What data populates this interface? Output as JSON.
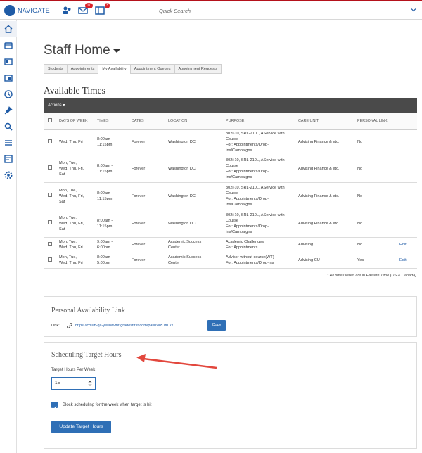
{
  "topbar": {
    "logo_text": "NAVIGATE",
    "badges": {
      "messages": "10",
      "tasks": "3"
    },
    "search_placeholder": "Quick Search"
  },
  "page": {
    "title": "Staff Home"
  },
  "tabs": [
    {
      "label": "Students"
    },
    {
      "label": "Appointments"
    },
    {
      "label": "My Availability"
    },
    {
      "label": "Appointment Queues"
    },
    {
      "label": "Appointment Requests"
    }
  ],
  "available": {
    "title": "Available Times",
    "actions_label": "Actions ▾",
    "headers": [
      "DAYS OF WEEK",
      "TIMES",
      "DATES",
      "LOCATION",
      "PURPOSE",
      "CARE UNIT",
      "PERSONAL LINK"
    ],
    "rows": [
      {
        "days": [
          "Wed, Thu, Fri"
        ],
        "times": [
          "8:00am -",
          "11:15pm"
        ],
        "dates": "Forever",
        "location": [
          "Washington DC"
        ],
        "purpose": [
          "302i-10, SRL-210L, AService with",
          "Course",
          "For: Appointments/Drop-",
          "Ins/Campaigns"
        ],
        "care_unit": "Advising Finance & etc.",
        "personal_link": "No",
        "edit": ""
      },
      {
        "days": [
          "Mon, Tue,",
          "Wed, Thu, Fri,",
          "Sat"
        ],
        "times": [
          "8:00am -",
          "11:15pm"
        ],
        "dates": "Forever",
        "location": [
          "Washington DC"
        ],
        "purpose": [
          "302i-10, SRL-210L, AService with",
          "Course",
          "For: Appointments/Drop-",
          "Ins/Campaigns"
        ],
        "care_unit": "Advising Finance & etc.",
        "personal_link": "No",
        "edit": ""
      },
      {
        "days": [
          "Mon, Tue,",
          "Wed, Thu, Fri,",
          "Sat"
        ],
        "times": [
          "8:00am -",
          "11:15pm"
        ],
        "dates": "Forever",
        "location": [
          "Washington DC"
        ],
        "purpose": [
          "302i-10, SRL-210L, AService with",
          "Course",
          "For: Appointments/Drop-",
          "Ins/Campaigns"
        ],
        "care_unit": "Advising Finance & etc.",
        "personal_link": "No",
        "edit": ""
      },
      {
        "days": [
          "Mon, Tue,",
          "Wed, Thu, Fri,",
          "Sat"
        ],
        "times": [
          "8:00am -",
          "11:15pm"
        ],
        "dates": "Forever",
        "location": [
          "Washington DC"
        ],
        "purpose": [
          "302i-10, SRL-210L, AService with",
          "Course",
          "For: Appointments/Drop-",
          "Ins/Campaigns"
        ],
        "care_unit": "Advising Finance & etc.",
        "personal_link": "No",
        "edit": ""
      },
      {
        "days": [
          "Mon, Tue,",
          "Wed, Thu, Fri"
        ],
        "times": [
          "9:00am -",
          "6:00pm"
        ],
        "dates": "Forever",
        "location": [
          "Academic Success",
          "Center"
        ],
        "purpose": [
          "Academic Challenges",
          "For: Appointments"
        ],
        "care_unit": "Advising",
        "personal_link": "No",
        "edit": "Edit"
      },
      {
        "days": [
          "Mon, Tue,",
          "Wed, Thu, Fri"
        ],
        "times": [
          "8:00am -",
          "5:00pm"
        ],
        "dates": "Forever",
        "location": [
          "Academic Success",
          "Center"
        ],
        "purpose": [
          "Advisor without course(WT)",
          "For: Appointments/Drop-Ins"
        ],
        "care_unit": "Advising CU",
        "personal_link": "Yes",
        "edit": "Edit"
      }
    ],
    "timezone_note": "* All times listed are in Eastern Time (US & Canada)"
  },
  "personal_link": {
    "title": "Personal Availability Link",
    "label": "Link:",
    "url": "https://coulb-qa-yellow-mt.gradesfirst.com/pal/0WzOtrLk7I",
    "copy_label": "Copy"
  },
  "target_hours": {
    "title": "Scheduling Target Hours",
    "field_label": "Target Hours Per Week",
    "value": "15",
    "checkbox_label": "Block scheduling for the week when target is hit",
    "checked": true,
    "button_label": "Update Target Hours"
  },
  "colors": {
    "brand": "#1f5ba6",
    "accent_red": "#e2473d",
    "primary_button": "#2f6fb6"
  }
}
